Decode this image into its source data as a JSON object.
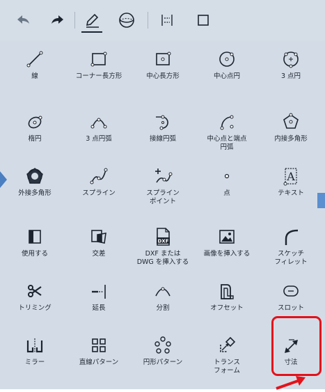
{
  "toolbar": {
    "items": [
      {
        "name": "undo-icon"
      },
      {
        "name": "redo-icon"
      },
      {
        "name": "sketch-pencil-icon"
      },
      {
        "name": "sphere-icon"
      },
      {
        "name": "constraints-icon"
      },
      {
        "name": "square-icon"
      }
    ]
  },
  "tools": {
    "line": "線",
    "corner_rect": "コーナー長方形",
    "center_rect": "中心長方形",
    "center_circle": "中心点円",
    "three_point_circle": "3 点円",
    "ellipse": "楕円",
    "three_point_arc": "3 点円弧",
    "tangent_arc": "接線円弧",
    "center_end_arc": "中心点と端点\n円弧",
    "inscribed_polygon": "内接多角形",
    "circumscribed_polygon": "外接多角形",
    "spline": "スプライン",
    "spline_point": "スプライン\nポイント",
    "point": "点",
    "text": "テキスト",
    "use": "使用する",
    "intersect": "交差",
    "dxf_dwg": "DXF または\nDWG を挿入する",
    "insert_image": "画像を挿入する",
    "sketch_fillet": "スケッチ\nフィレット",
    "trim": "トリミング",
    "extend": "延長",
    "split": "分割",
    "offset": "オフセット",
    "slot": "スロット",
    "mirror": "ミラー",
    "linear_pattern": "直線パターン",
    "circular_pattern": "円形パターン",
    "transform": "トランス\nフォーム",
    "dimension": "寸法"
  },
  "icon_texts": {
    "dxf_badge": "DXF",
    "text_glyph": "A"
  },
  "colors": {
    "panel": "#d3dce6",
    "icon": "#1c2430",
    "accent_blue": "#4a7fc1",
    "highlight_red": "#e3121b"
  }
}
